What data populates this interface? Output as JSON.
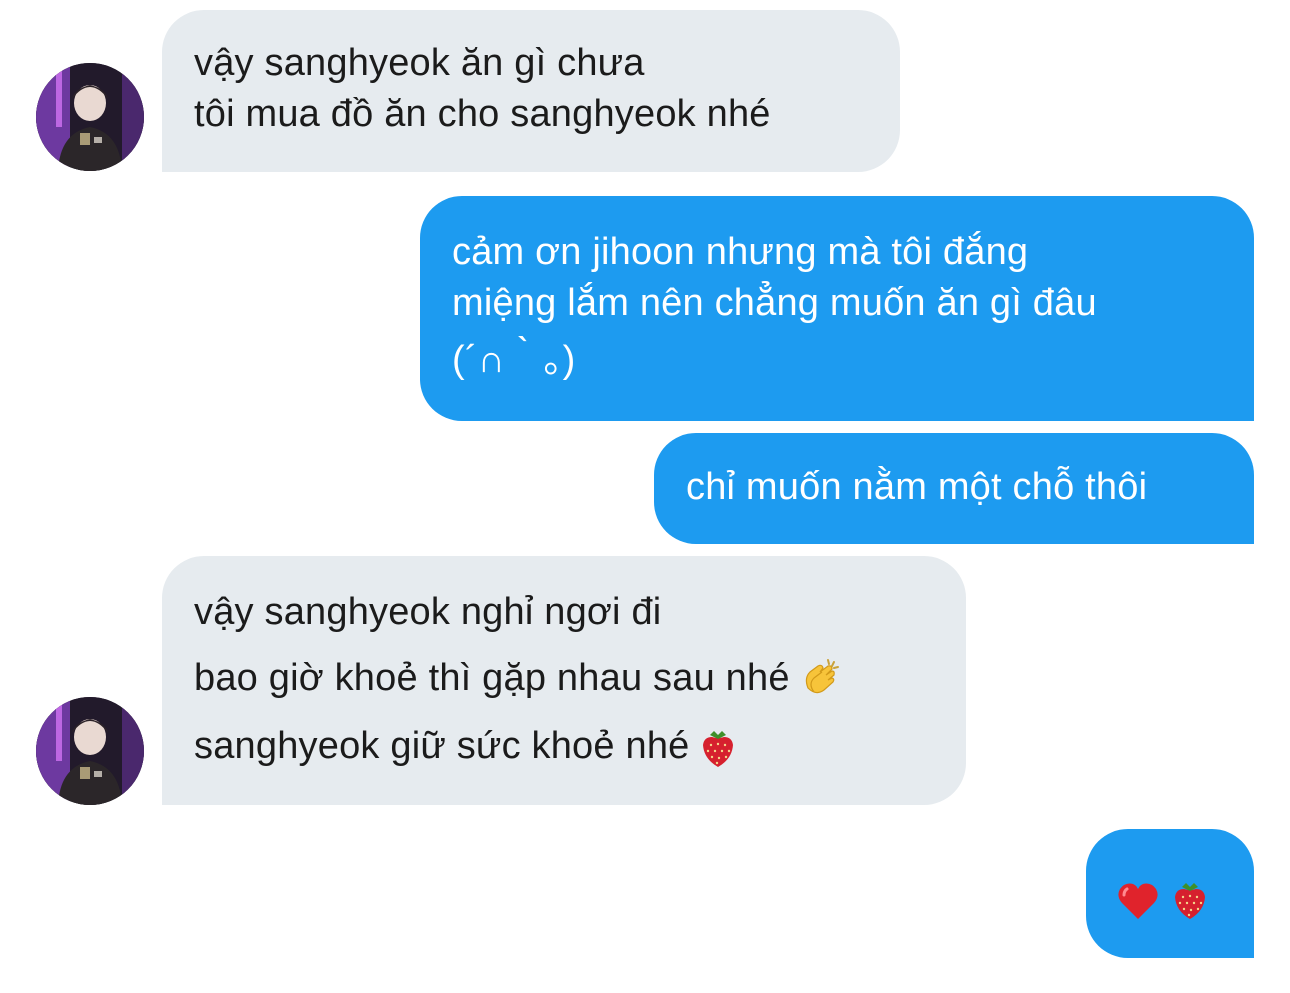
{
  "conversation": {
    "messages": [
      {
        "direction": "incoming",
        "lines": [
          "vậy sanghyeok ăn gì chưa",
          "tôi mua đồ ăn cho sanghyeok nhé"
        ]
      },
      {
        "direction": "outgoing",
        "lines": [
          "cảm ơn jihoon nhưng mà tôi đắng",
          "miệng lắm nên chẳng muốn ăn gì đâu",
          "(´∩｀。)"
        ]
      },
      {
        "direction": "outgoing",
        "lines": [
          "chỉ muốn nằm một chỗ thôi"
        ]
      },
      {
        "direction": "incoming",
        "lines": [
          "vậy sanghyeok nghỉ ngơi đi",
          "bao giờ khoẻ thì gặp nhau sau nhé",
          "sanghyeok giữ sức khoẻ nhé"
        ],
        "emojis": [
          "clapping-hands",
          "strawberry"
        ]
      },
      {
        "direction": "outgoing",
        "emojis": [
          "red-heart",
          "strawberry"
        ]
      }
    ]
  },
  "colors": {
    "incoming_bubble": "#e6ebef",
    "outgoing_bubble": "#1d9bf0",
    "incoming_text": "#1b1b1b",
    "outgoing_text": "#ffffff"
  }
}
